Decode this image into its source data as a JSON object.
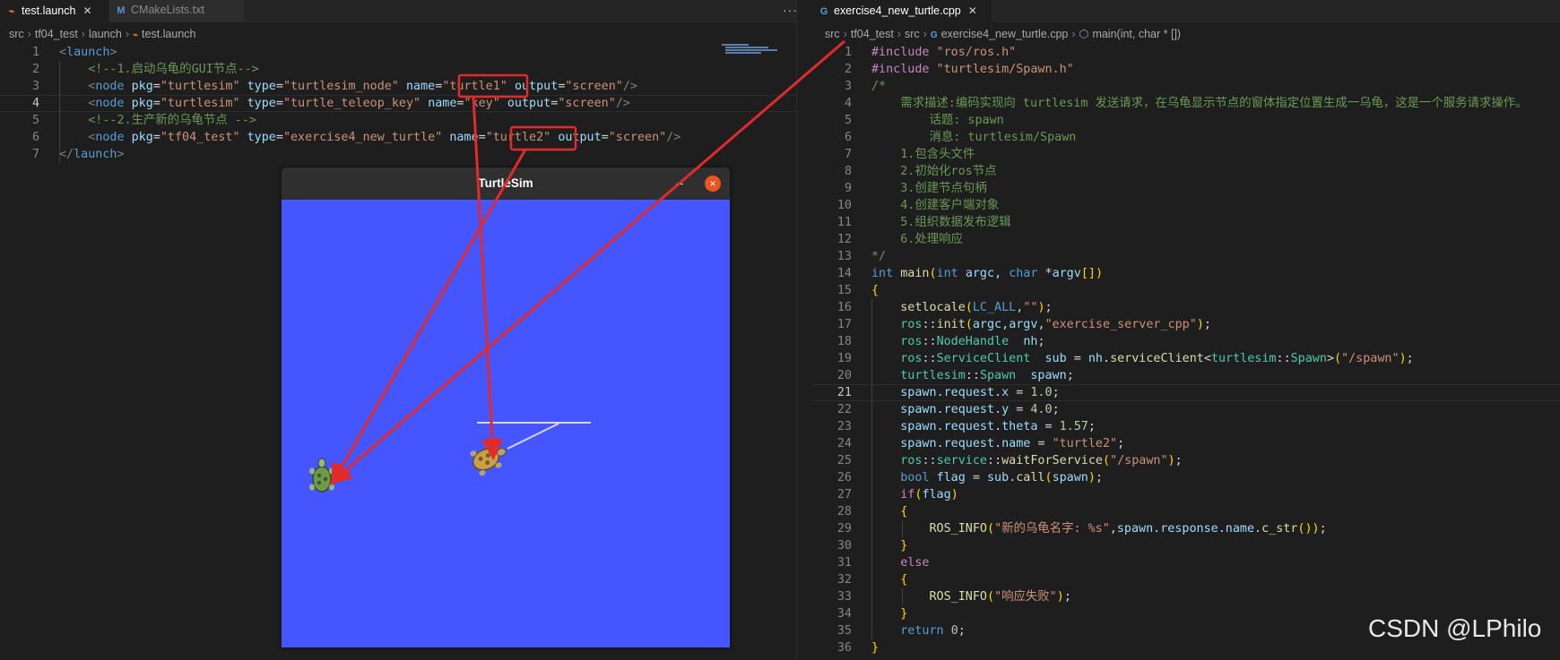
{
  "left_editor": {
    "tabs": [
      {
        "label": "test.launch",
        "icon": "rss-icon",
        "active": true
      },
      {
        "label": "CMakeLists.txt",
        "icon": "m-file-icon",
        "active": false
      }
    ],
    "more_label": "···",
    "breadcrumb": {
      "parts": [
        "src",
        "tf04_test",
        "launch"
      ],
      "file": "test.launch"
    },
    "line_numbers": [
      "1",
      "2",
      "3",
      "4",
      "5",
      "6",
      "7"
    ],
    "lines": [
      {
        "pre": "",
        "open": "<",
        "tag": "launch",
        "close": ">"
      },
      {
        "comment": "<!--1.启动乌龟的GUI节点-->"
      },
      {
        "pkg": "turtlesim",
        "type": "turtlesim_node",
        "name": "turtle1",
        "output": "screen"
      },
      {
        "pkg": "turtlesim",
        "type": "turtle_teleop_key",
        "name": "key",
        "output": "screen"
      },
      {
        "comment": "<!--2.生产新的乌龟节点 -->"
      },
      {
        "pkg": "tf04_test",
        "type": "exercise4_new_turtle",
        "name": "turtle2",
        "output": "screen"
      },
      {
        "closing": "launch"
      }
    ],
    "attr_names": {
      "pkg": "pkg",
      "type": "type",
      "name": "name",
      "output": "output",
      "node": "node"
    }
  },
  "right_editor": {
    "tab": {
      "label": "exercise4_new_turtle.cpp",
      "icon": "cpp-icon",
      "active": true
    },
    "breadcrumb": {
      "parts": [
        "src",
        "tf04_test",
        "src"
      ],
      "file": "exercise4_new_turtle.cpp",
      "symbol": "main(int, char * [])"
    },
    "code": [
      "#include \"ros/ros.h\"",
      "#include \"turtlesim/Spawn.h\"",
      "/*",
      "    需求描述:编码实现向 turtlesim 发送请求，在乌龟显示节点的窗体指定位置生成一乌龟，这是一个服务请求操作。",
      "        话题: spawn",
      "        消息: turtlesim/Spawn",
      "    1.包含头文件",
      "    2.初始化ros节点",
      "    3.创建节点句柄",
      "    4.创建客户端对象",
      "    5.组织数据发布逻辑",
      "    6.处理响应",
      "*/",
      "int main(int argc, char *argv[])",
      "{",
      "    setlocale(LC_ALL,\"\");",
      "    ros::init(argc,argv,\"exercise_server_cpp\");",
      "    ros::NodeHandle  nh;",
      "    ros::ServiceClient  sub = nh.serviceClient<turtlesim::Spawn>(\"/spawn\");",
      "    turtlesim::Spawn  spawn;",
      "    spawn.request.x = 1.0;",
      "    spawn.request.y = 4.0;",
      "    spawn.request.theta = 1.57;",
      "    spawn.request.name = \"turtle2\";",
      "    ros::service::waitForService(\"/spawn\");",
      "    bool flag = sub.call(spawn);",
      "    if(flag)",
      "    {",
      "        ROS_INFO(\"新的乌龟名字: %s\",spawn.response.name.c_str());",
      "    }",
      "    else",
      "    {",
      "        ROS_INFO(\"响应失败\");",
      "    }",
      "    return 0;",
      "}"
    ],
    "current_line": 21
  },
  "turtlesim_window": {
    "title": "TurtleSim",
    "minimize_label": "–",
    "close_label": "×",
    "background_color": "#4556ff",
    "turtles": [
      {
        "name": "turtle1",
        "icon": "turtle-icon"
      },
      {
        "name": "turtle2",
        "icon": "turtle-icon"
      }
    ]
  },
  "watermark": "CSDN @LPhilo",
  "colors": {
    "annotation_red": "#e32a2a",
    "editor_bg": "#1e1e1e"
  }
}
